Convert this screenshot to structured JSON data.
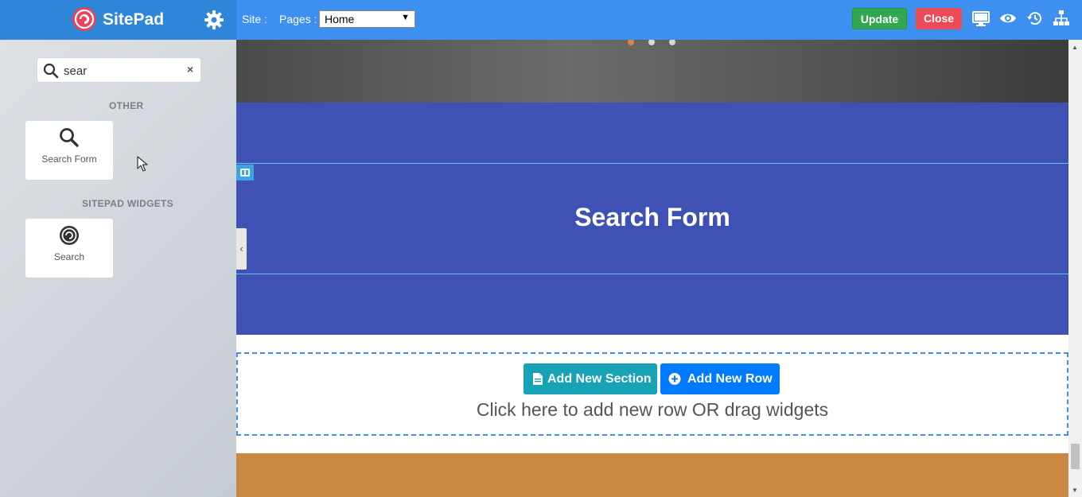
{
  "brand": {
    "name": "SitePad",
    "logo_icon": "sitepad-logo-icon",
    "settings_icon": "gear-icon"
  },
  "toolbar": {
    "site_label": "Site :",
    "pages_label": "Pages :",
    "pages_selected": "Home",
    "update_label": "Update",
    "close_label": "Close",
    "icons": [
      "desktop-icon",
      "eye-icon",
      "history-icon",
      "sitemap-icon"
    ],
    "colors": {
      "topbar": "#3d8ff0",
      "update": "#2fa84f",
      "close": "#ec4a56"
    }
  },
  "sidebar": {
    "search": {
      "value": "sear",
      "placeholder": "",
      "clear_glyph": "×"
    },
    "categories": [
      {
        "label": "OTHER",
        "widgets": [
          {
            "label": "Search Form",
            "icon": "search-icon"
          }
        ]
      },
      {
        "label": "SITEPAD WIDGETS",
        "widgets": [
          {
            "label": "Search",
            "icon": "sitepad-logo-icon"
          }
        ]
      }
    ]
  },
  "canvas": {
    "section_title": "Search Form",
    "collapse_glyph": "‹",
    "add_section_label": "Add New Section",
    "add_row_label": "Add New Row",
    "drop_hint": "Click here to add new row OR drag widgets",
    "colors": {
      "blue_section": "#3f51b5",
      "orange_section": "#c98844",
      "add_section": "#17a2b8",
      "add_row": "#007bff"
    }
  }
}
